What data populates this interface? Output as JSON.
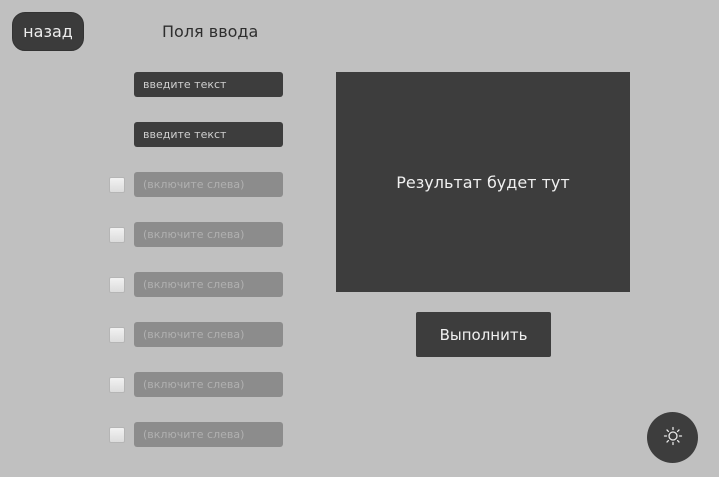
{
  "header": {
    "back_label": "назад",
    "title": "Поля ввода"
  },
  "inputs": {
    "field1_placeholder": "введите текст",
    "field2_placeholder": "введите текст",
    "optional_placeholder": "(включите слева)"
  },
  "result": {
    "text": "Результат будет тут"
  },
  "actions": {
    "run_label": "Выполнить",
    "theme_icon": "sun-icon"
  },
  "colors": {
    "background": "#c0c0c0",
    "panel": "#3d3d3d",
    "disabled_field": "#8c8c8c"
  }
}
